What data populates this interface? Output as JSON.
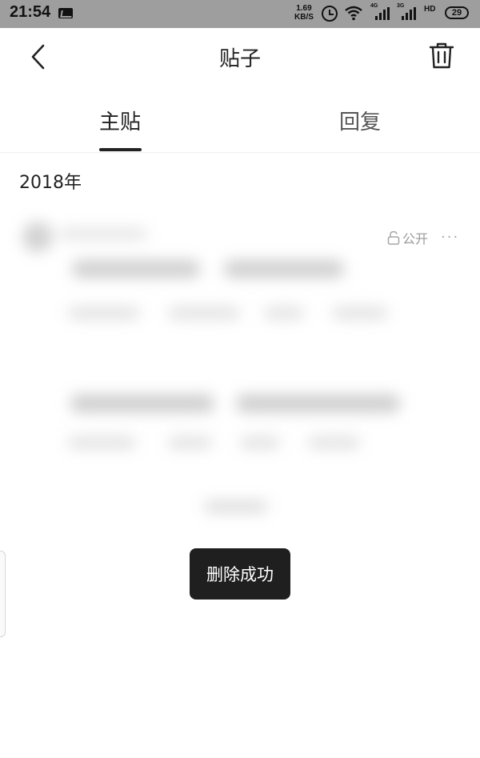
{
  "status_bar": {
    "time": "21:54",
    "net_speed_value": "1.69",
    "net_speed_unit": "KB/S",
    "signal1_label": "4G",
    "signal2_label": "3G",
    "hd_label": "HD",
    "battery": "29"
  },
  "header": {
    "title": "贴子"
  },
  "tabs": [
    {
      "label": "主贴",
      "active": true
    },
    {
      "label": "回复",
      "active": false
    }
  ],
  "content": {
    "year": "2018年",
    "post": {
      "privacy_label": "公开",
      "more_label": "···"
    }
  },
  "toast": {
    "message": "删除成功"
  }
}
